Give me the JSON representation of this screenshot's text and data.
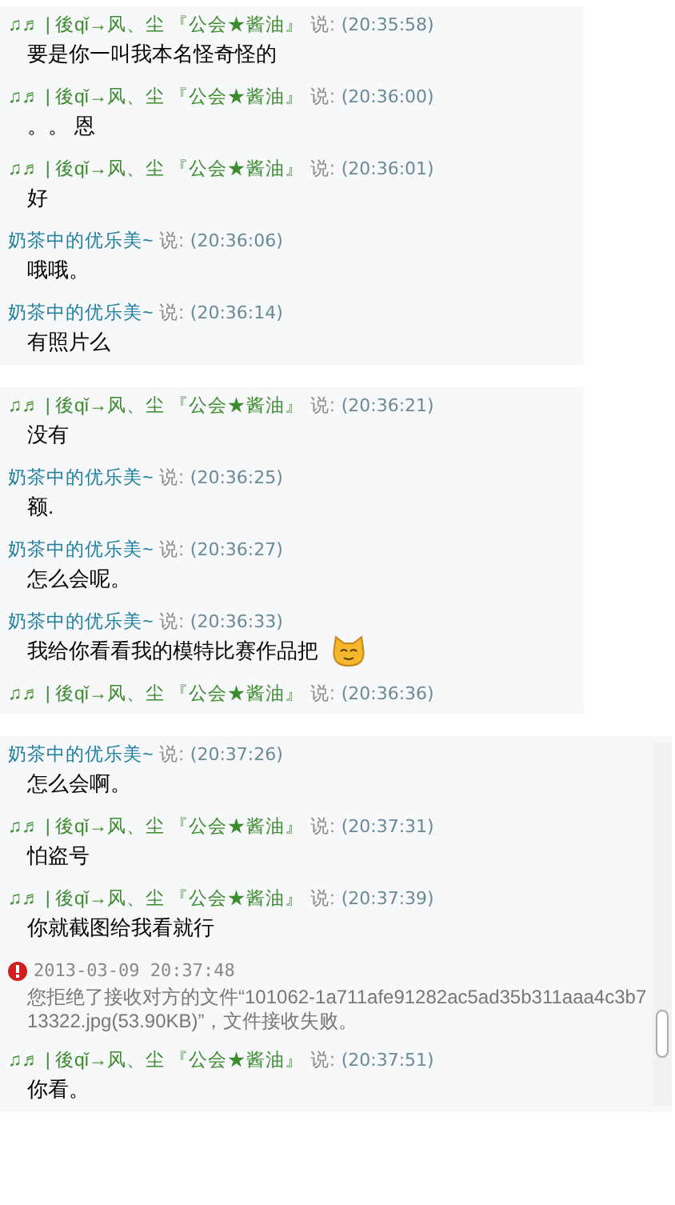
{
  "panels": [
    {
      "messages": [
        {
          "kind": "chat",
          "sender": "♫♬ | 後qǐ→风、尘 『公会★酱油』",
          "color": "#3d8b2f",
          "says": "说:",
          "time": "(20:35:58)",
          "text": "要是你一叫我本名怪奇怪的"
        },
        {
          "kind": "chat",
          "sender": "♫♬ | 後qǐ→风、尘 『公会★酱油』",
          "color": "#3d8b2f",
          "says": "说:",
          "time": "(20:36:00)",
          "text": "。。 恩"
        },
        {
          "kind": "chat",
          "sender": "♫♬ | 後qǐ→风、尘 『公会★酱油』",
          "color": "#3d8b2f",
          "says": "说:",
          "time": "(20:36:01)",
          "text": "好"
        },
        {
          "kind": "chat",
          "sender": "奶茶中的优乐美~",
          "color": "#1e7f9e",
          "says": "说:",
          "time": "(20:36:06)",
          "text": "哦哦。"
        },
        {
          "kind": "chat",
          "sender": "奶茶中的优乐美~",
          "color": "#1e7f9e",
          "says": "说:",
          "time": "(20:36:14)",
          "text": "有照片么"
        }
      ]
    },
    {
      "messages": [
        {
          "kind": "chat",
          "sender": "♫♬ | 後qǐ→风、尘 『公会★酱油』",
          "color": "#3d8b2f",
          "says": "说:",
          "time": "(20:36:21)",
          "text": "没有"
        },
        {
          "kind": "chat",
          "sender": "奶茶中的优乐美~",
          "color": "#1e7f9e",
          "says": "说:",
          "time": "(20:36:25)",
          "text": "额."
        },
        {
          "kind": "chat",
          "sender": "奶茶中的优乐美~",
          "color": "#1e7f9e",
          "says": "说:",
          "time": "(20:36:27)",
          "text": "怎么会呢。"
        },
        {
          "kind": "chat",
          "sender": "奶茶中的优乐美~",
          "color": "#1e7f9e",
          "says": "说:",
          "time": "(20:36:33)",
          "text": "我给你看看我的模特比赛作品把",
          "sticker": true
        },
        {
          "kind": "chat",
          "sender": "♫♬ | 後qǐ→风、尘 『公会★酱油』",
          "color": "#3d8b2f",
          "says": "说:",
          "time": "(20:36:36)"
        }
      ]
    },
    {
      "scrollbar": true,
      "messages": [
        {
          "kind": "chat",
          "sender": "奶茶中的优乐美~",
          "color": "#1e7f9e",
          "says": "说:",
          "time": "(20:37:26)",
          "text": "怎么会啊。"
        },
        {
          "kind": "chat",
          "sender": "♫♬ | 後qǐ→风、尘 『公会★酱油』",
          "color": "#3d8b2f",
          "says": "说:",
          "time": "(20:37:31)",
          "text": "怕盗号"
        },
        {
          "kind": "chat",
          "sender": "♫♬ | 後qǐ→风、尘 『公会★酱油』",
          "color": "#3d8b2f",
          "says": "说:",
          "time": "(20:37:39)",
          "text": "你就截图给我看就行"
        },
        {
          "kind": "system",
          "time": "2013-03-09 20:37:48",
          "text": "您拒绝了接收对方的文件“101062-1a711afe91282ac5ad35b311aaa4c3b713322.jpg(53.90KB)”，文件接收失败。"
        },
        {
          "kind": "chat",
          "sender": "♫♬ | 後qǐ→风、尘 『公会★酱油』",
          "color": "#3d8b2f",
          "says": "说:",
          "time": "(20:37:51)",
          "text": "你看。"
        }
      ]
    }
  ]
}
